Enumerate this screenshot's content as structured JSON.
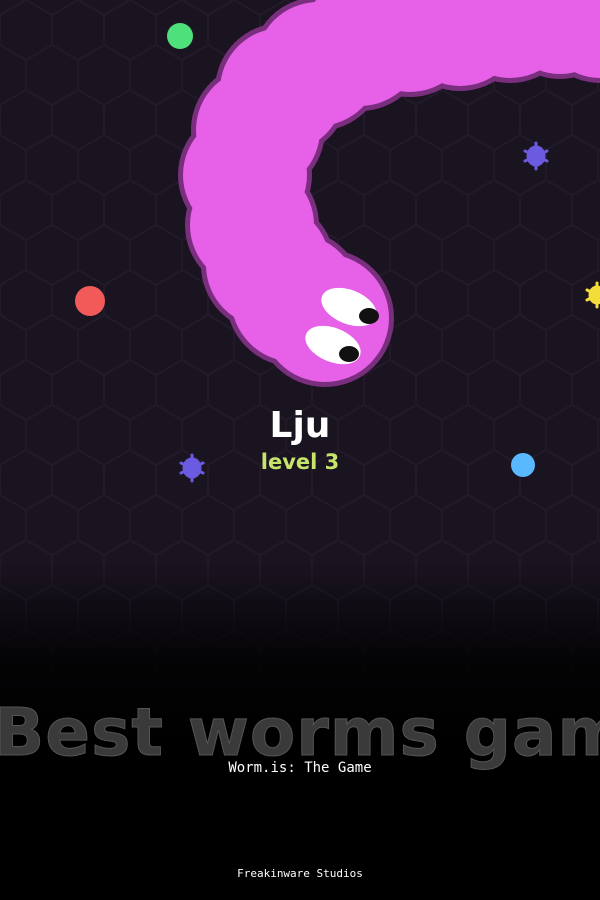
{
  "player": {
    "name": "Lju",
    "level": "level 3",
    "worm_color": "#e660e8",
    "worm_outline": "#7a2f7e"
  },
  "banner": {
    "tagline": "Best worms game!",
    "title": "Worm.is: The Game",
    "studio": "Freakinware Studios"
  },
  "colors": {
    "background": "#1a1420",
    "level_text": "#c6e56a",
    "food_green": "#4ee07a",
    "food_red": "#f25a5a",
    "food_blue": "#5ab8ff",
    "bug_purple": "#6a5be0",
    "bug_yellow": "#f2dd3a"
  }
}
